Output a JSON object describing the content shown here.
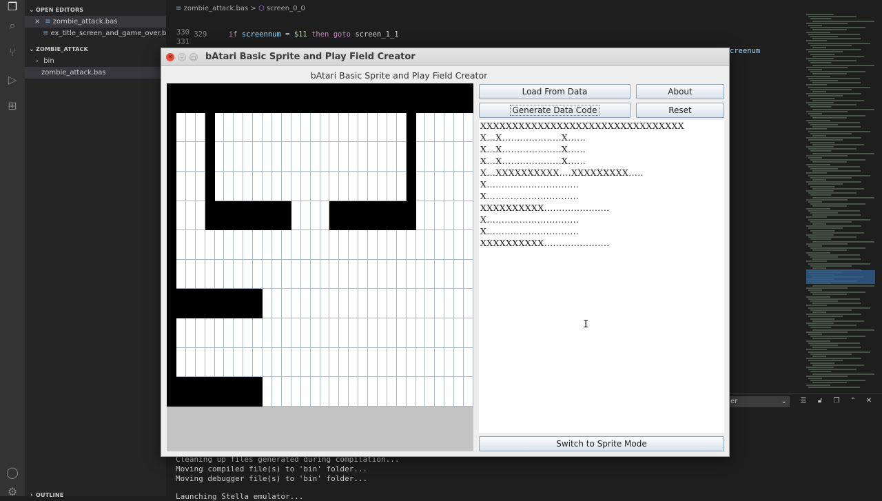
{
  "vscode": {
    "sidebar": {
      "open_editors_header": "OPEN EDITORS",
      "open_editors": [
        {
          "name": "zombie_attack.bas",
          "close": "×",
          "icon": "≡"
        },
        {
          "name": "ex_title_screen_and_game_over.ba...",
          "icon": "≡"
        }
      ],
      "project_header": "ZOMBIE_ATTACK",
      "project_items": [
        {
          "name": "bin",
          "chevron": "›"
        },
        {
          "name": "zombie_attack.bas"
        }
      ],
      "outline_header": "OUTLINE"
    },
    "breadcrumb": {
      "file": "zombie_attack.bas",
      "separator": ">",
      "symbol": "screen_0_0"
    },
    "code_lines": [
      {
        "num": "329",
        "kw1": "if",
        "ident": "screennum",
        "op": " = ",
        "value": "$11",
        "kw2": "then",
        "kw3": "goto",
        "target": "screen_1_1"
      },
      {
        "num": "330"
      },
      {
        "num": "331"
      }
    ],
    "code_overflow_text": "creenum",
    "panel_dropdown": "er",
    "terminal_lines": [
      "Cleaning up files generated during compilation...",
      "Moving compiled file(s) to 'bin' folder...",
      "Moving debugger file(s) to 'bin' folder...",
      "",
      "Launching Stella emulator..."
    ]
  },
  "app": {
    "window_title": "bAtari Basic Sprite and Play Field Creator",
    "heading": "bAtari Basic Sprite and Play Field Creator",
    "buttons": {
      "load": "Load From Data",
      "about": "About",
      "generate": "Generate Data Code",
      "reset": "Reset",
      "switch": "Switch to Sprite Mode"
    },
    "playfield_rows": [
      "XXXXXXXXXXXXXXXXXXXXXXXXXXXXXXXX",
      "X...X....................X......",
      "X...X....................X......",
      "X...X....................X......",
      "X...XXXXXXXXX....XXXXXXXXX......",
      "X...............................",
      "X...............................",
      "XXXXXXXXXX......................",
      "X...............................",
      "X...............................",
      "XXXXXXXXXX......................"
    ],
    "data_text": [
      "XXXXXXXXXXXXXXXXXXXXXXXXXXXXXXXX",
      "X...X....................X......",
      "X...X....................X......",
      "X...X....................X......",
      "X...XXXXXXXXXX....XXXXXXXXX.....",
      "X...............................",
      "X...............................",
      "XXXXXXXXXX......................",
      "X...............................",
      "X...............................",
      "XXXXXXXXXX......................"
    ]
  }
}
